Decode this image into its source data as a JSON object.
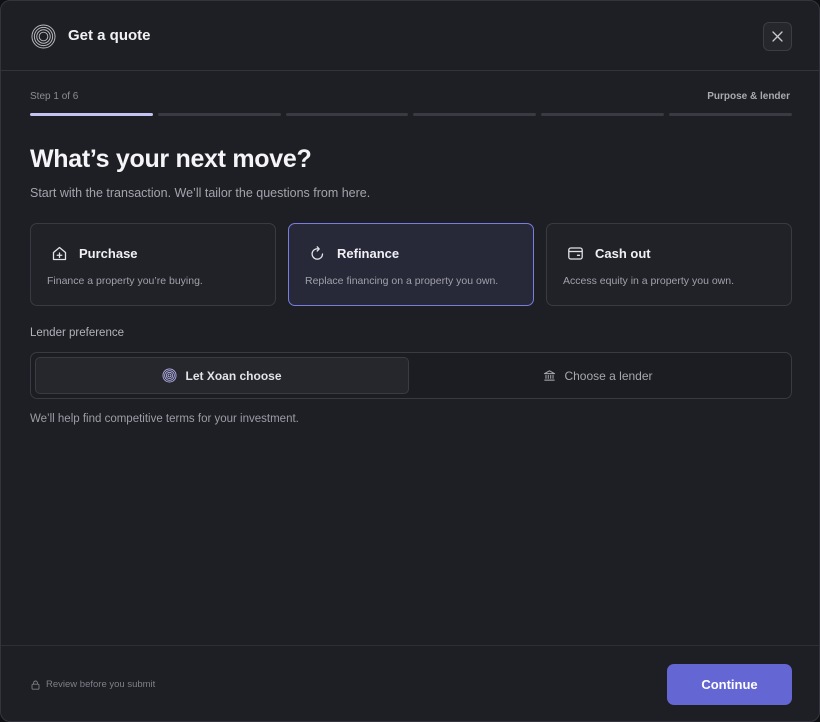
{
  "header": {
    "title": "Get a quote",
    "close_icon": "close-icon",
    "logo_icon": "concentric-rings-logo"
  },
  "steps": {
    "current_label": "Step 1 of 6",
    "section_label": "Purpose & lender",
    "total": 6,
    "current": 1
  },
  "main": {
    "heading": "What’s your next move?",
    "subheading": "Start with the transaction. We’ll tailor the questions from here.",
    "options": [
      {
        "title": "Purchase",
        "description": "Finance a property you’re buying.",
        "icon": "house-plus-icon",
        "selected": false
      },
      {
        "title": "Refinance",
        "description": "Replace financing on a property you own.",
        "icon": "refresh-icon",
        "selected": true
      },
      {
        "title": "Cash out",
        "description": "Access equity in a property you own.",
        "icon": "wallet-icon",
        "selected": false
      }
    ],
    "lender_label": "Lender preference",
    "lender_options": [
      {
        "label": "Let Xoan choose",
        "icon": "xoan-logo-icon",
        "selected": true
      },
      {
        "label": "Choose a lender",
        "icon": "bank-icon",
        "selected": false
      }
    ],
    "hint": "We’ll help find competitive terms for your investment."
  },
  "footer": {
    "note": "Review before you submit",
    "note_icon": "lock-icon",
    "continue_label": "Continue"
  },
  "colors": {
    "accent": "#6466d4",
    "selected_border": "#7a7ce0",
    "progress_active": "#c3c2f2",
    "background": "#1e1f24"
  }
}
